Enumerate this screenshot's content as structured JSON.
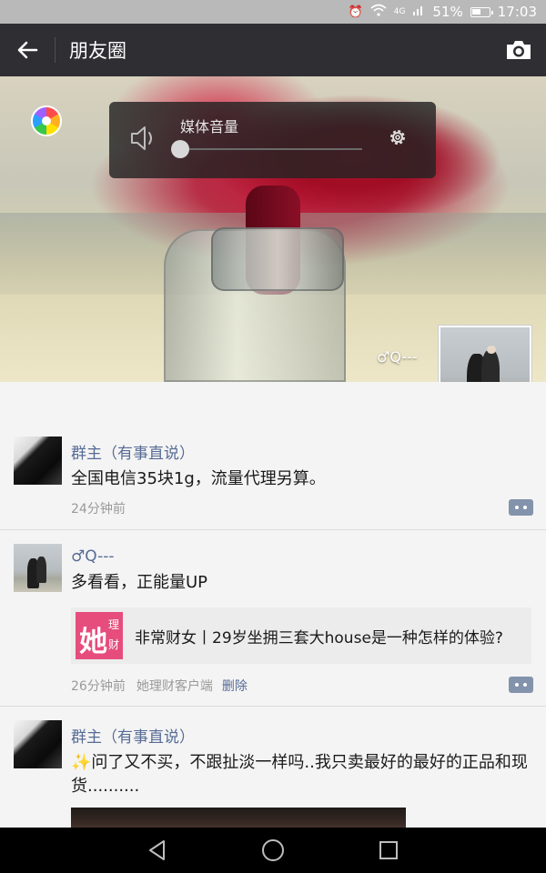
{
  "status_bar": {
    "network": "4G",
    "battery": "51%",
    "time": "17:03"
  },
  "header": {
    "title": "朋友圈",
    "back_icon": "arrow-left-icon",
    "camera_icon": "camera-icon"
  },
  "volume_overlay": {
    "label": "媒体音量",
    "level": 0,
    "speaker_icon": "speaker-icon",
    "settings_icon": "gear-icon"
  },
  "cover": {
    "user_name": "♂Q---"
  },
  "posts": [
    {
      "name": "群主（有事直说）",
      "text": "全国电信35块1g，流量代理另算。",
      "time": "24分钟前"
    },
    {
      "name": "♂Q---",
      "text": "多看看，正能量UP",
      "link_title": "非常财女丨29岁坐拥三套大house是一种怎样的体验?",
      "link_logo_big": "她",
      "link_logo_small_1": "理",
      "link_logo_small_2": "财",
      "time": "26分钟前",
      "source": "她理财客户端",
      "delete_label": "删除"
    },
    {
      "name": "群主（有事直说）",
      "text": "✨问了又不买，不跟扯淡一样吗..我只卖最好的最好的正品和现货.........."
    }
  ],
  "nav": {
    "back": "triangle-back-icon",
    "home": "circle-home-icon",
    "recents": "square-recents-icon"
  }
}
